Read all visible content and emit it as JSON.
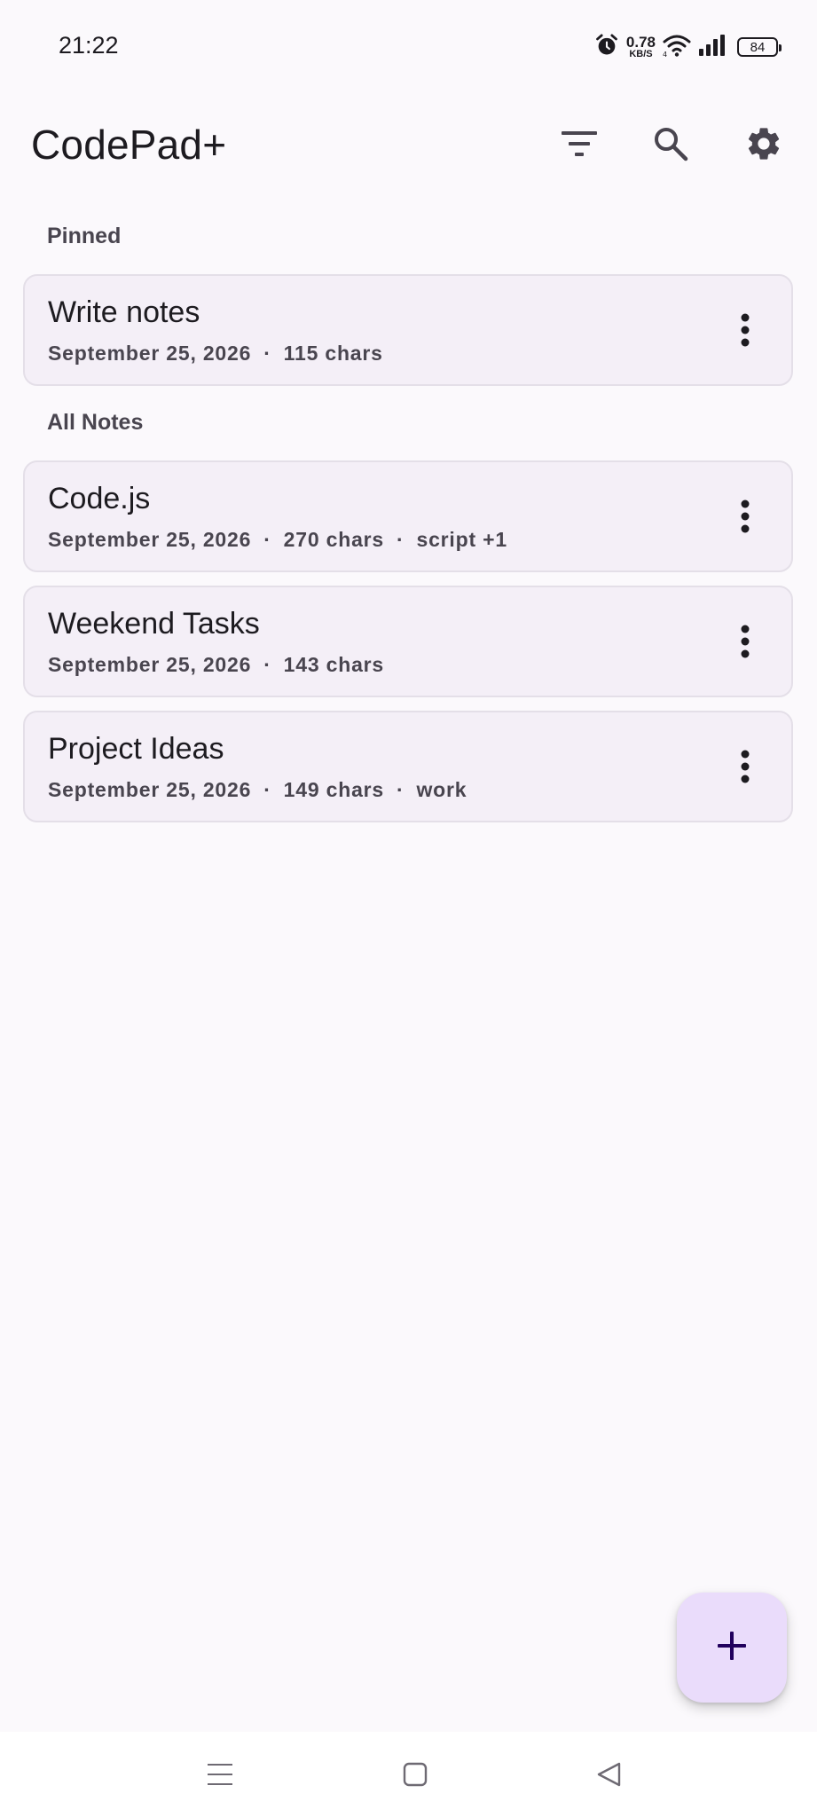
{
  "status_bar": {
    "time": "21:22",
    "net_speed_value": "0.78",
    "net_speed_unit": "KB/S",
    "battery_level": "84",
    "icons": [
      "alarm-icon",
      "wifi-icon",
      "signal-icon",
      "battery-icon"
    ]
  },
  "app_bar": {
    "title": "CodePad+",
    "actions": [
      "filter-icon",
      "search-icon",
      "gear-icon"
    ]
  },
  "sections": {
    "pinned_label": "Pinned",
    "all_label": "All Notes"
  },
  "pinned_notes": [
    {
      "title": "Write notes",
      "date": "September 25, 2026",
      "chars": "115 chars"
    }
  ],
  "notes": [
    {
      "title": "Code.js",
      "date": "September 25, 2026",
      "chars": "270 chars",
      "tags": "script +1"
    },
    {
      "title": "Weekend Tasks",
      "date": "September 25, 2026",
      "chars": "143 chars"
    },
    {
      "title": "Project Ideas",
      "date": "September 25, 2026",
      "chars": "149 chars",
      "tags": "work"
    }
  ],
  "separator": "·",
  "fab": {
    "icon": "plus-icon"
  },
  "nav_bar": {
    "icons": [
      "menu-icon",
      "home-icon",
      "back-icon"
    ]
  },
  "colors": {
    "background": "#fbf9fc",
    "card": "#f4eff7",
    "card_border": "#e4dfe8",
    "fab": "#eadcfb",
    "text_primary": "#1d1b20",
    "text_secondary": "#49454f"
  }
}
